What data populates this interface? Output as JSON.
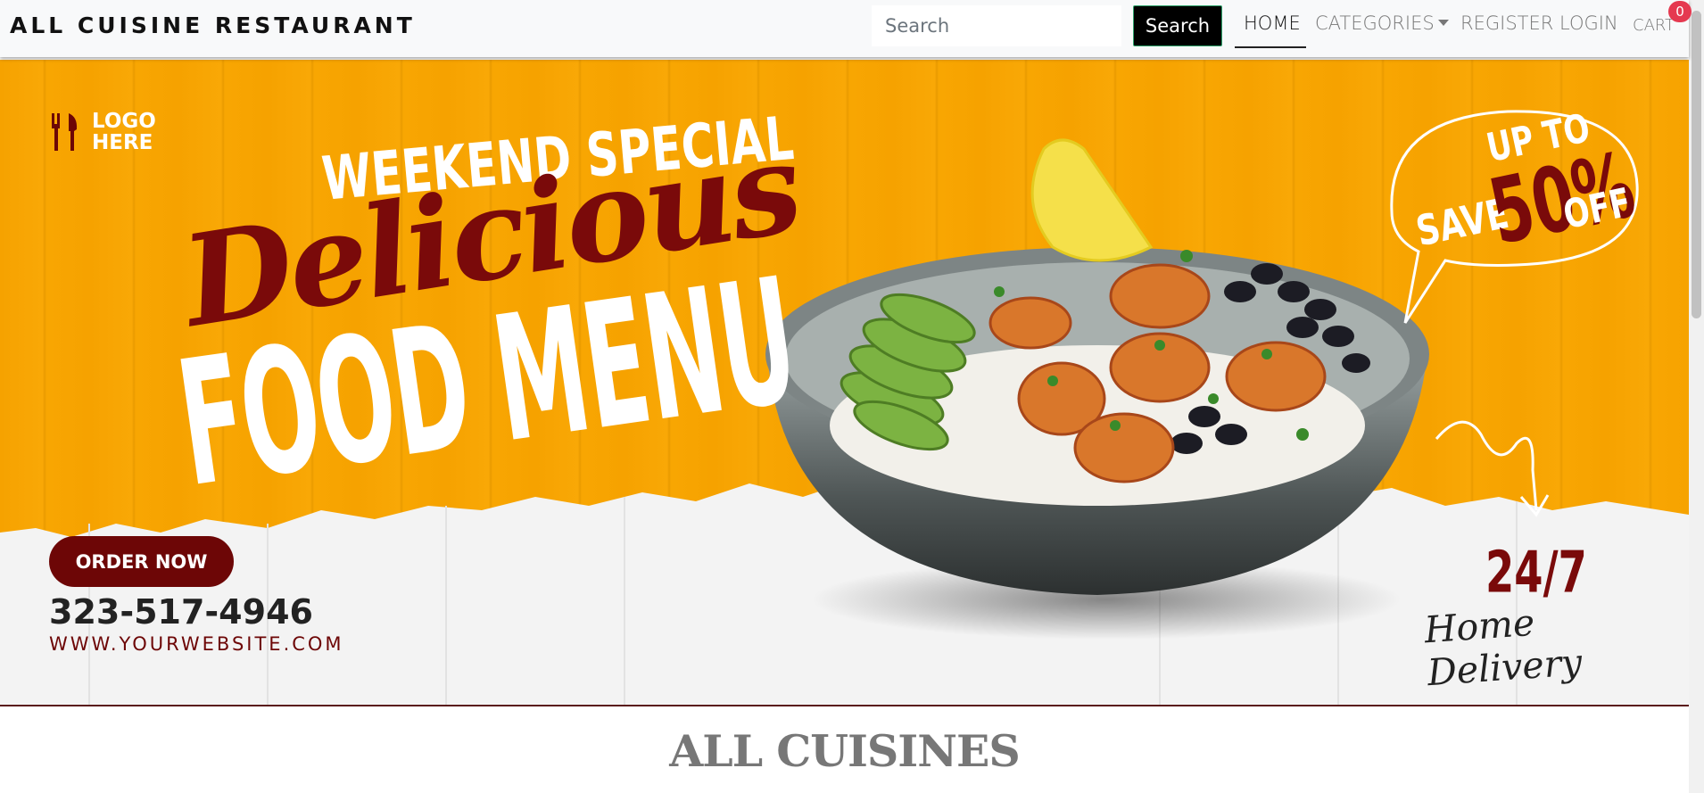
{
  "navbar": {
    "brand": "ALL CUISINE RESTAURANT",
    "search_placeholder": "Search",
    "search_button": "Search",
    "links": {
      "home": "HOME",
      "categories": "CATEGORIES",
      "register": "REGISTER",
      "login": "LOGIN",
      "cart": "CART"
    },
    "cart_count": "0"
  },
  "banner": {
    "logo_line1": "LOGO",
    "logo_line2": "HERE",
    "weekend_special": "WEEKEND SPECIAL",
    "delicious": "Delicious",
    "food_menu": "FOOD MENU",
    "up_to": "UP TO",
    "save": "SAVE",
    "percent": "50%",
    "off": "OFF",
    "order_now": "ORDER NOW",
    "phone": "323-517-4946",
    "website": "WWW.YOURWEBSITE.COM",
    "hours": "24/7",
    "delivery": "Home Delivery"
  },
  "main": {
    "heading": "ALL CUISINES"
  },
  "colors": {
    "banner_orange": "#f6a200",
    "maroon": "#7a0a0a",
    "badge_red": "#e53950"
  }
}
